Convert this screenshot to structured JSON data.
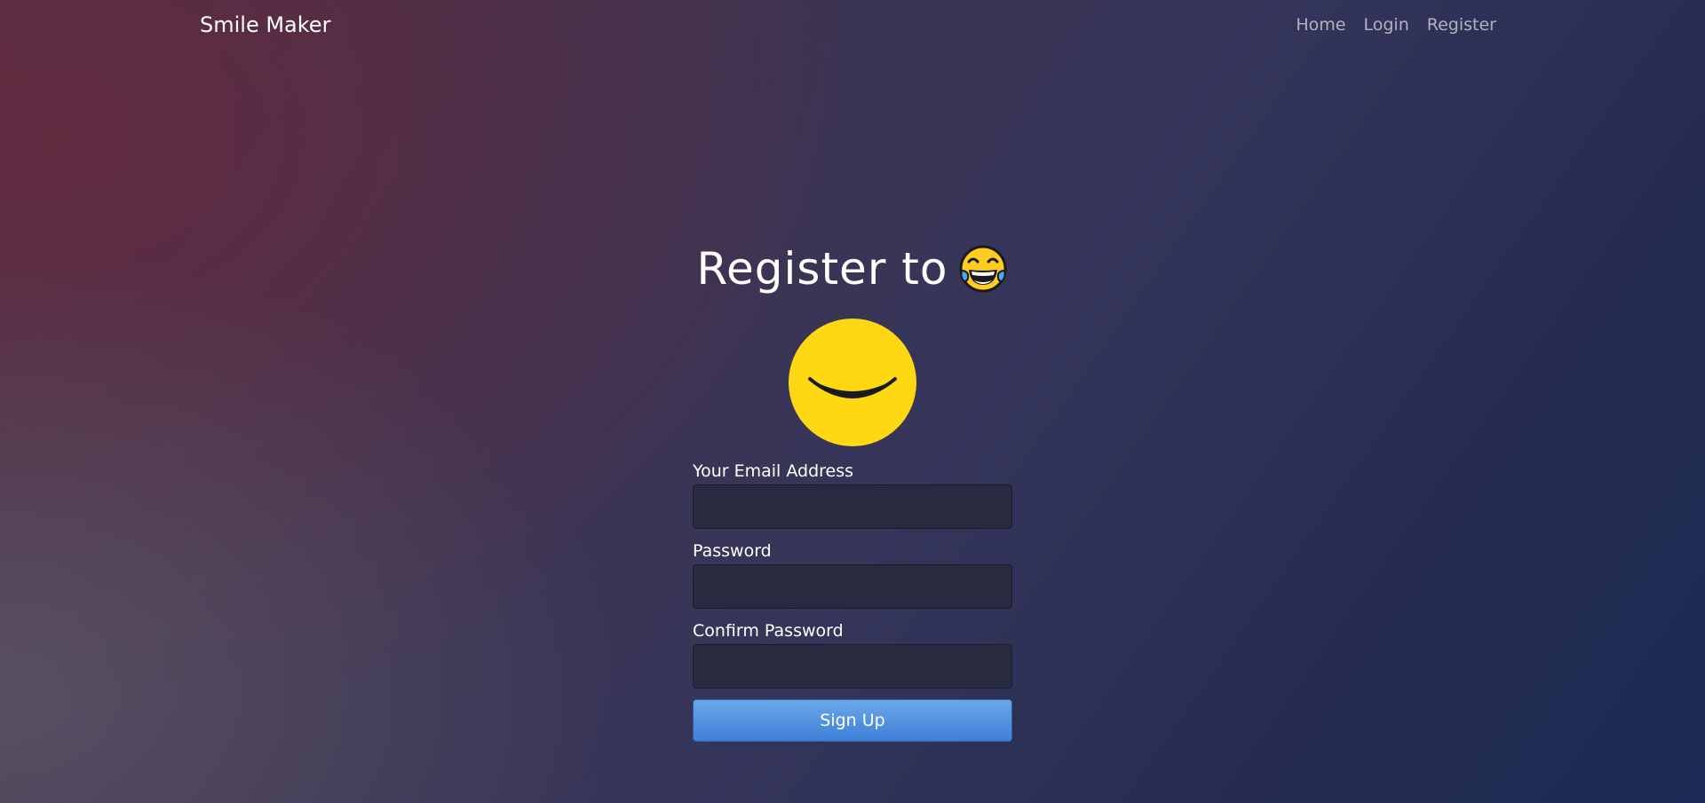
{
  "navbar": {
    "brand": "Smile Maker",
    "links": [
      "Home",
      "Login",
      "Register"
    ]
  },
  "page": {
    "title": "Register to",
    "title_emoji_icon": "face-with-tears-of-joy-icon",
    "hero_icon": "smiley-face-icon"
  },
  "form": {
    "email_label": "Your Email Address",
    "email_value": "",
    "password_label": "Password",
    "password_value": "",
    "confirm_label": "Confirm Password",
    "confirm_value": "",
    "submit_label": "Sign Up"
  },
  "colors": {
    "smiley_yellow": "#ffd814",
    "button_blue": "#4a8ae0",
    "input_bg": "#282a3f"
  }
}
